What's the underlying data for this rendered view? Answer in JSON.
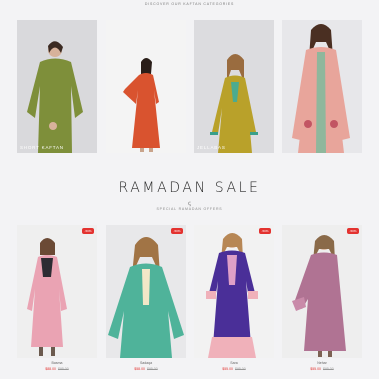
{
  "header": {
    "caption": "DISCOVER OUR KAFTAN CATEGORIES"
  },
  "categories": [
    {
      "label": "SHORT KAFTAN",
      "bg": "#d9d9dc",
      "dress": "#7e8f3a"
    },
    {
      "label": "",
      "bg": "#f4f4f4",
      "dress": "#d9532f"
    },
    {
      "label": "JELLABAS",
      "bg": "#dcdcdf",
      "dress": "#b9a12a"
    },
    {
      "label": "",
      "bg": "#e7e7ea",
      "dress": "#e8a59b"
    }
  ],
  "sale": {
    "title": "RAMADAN SALE",
    "ornament": "ꞔ",
    "subtitle": "SPECIAL RAMADAN OFFERS"
  },
  "products": [
    {
      "badge": "-50%",
      "name": "Basma",
      "price_now": "$88.00",
      "price_was": "$95.00",
      "bg": "#efefef",
      "dress": "#eaa3b3"
    },
    {
      "badge": "-50%",
      "name": "Sadaqa",
      "price_now": "$58.00",
      "price_was": "$95.00",
      "bg": "#e8e8ea",
      "dress": "#4fb39a"
    },
    {
      "badge": "-50%",
      "name": "Sara",
      "price_now": "$55.00",
      "price_was": "$95.00",
      "bg": "#f2f2f2",
      "dress": "#4a2f98"
    },
    {
      "badge": "-50%",
      "name": "Nehar",
      "price_now": "$55.00",
      "price_was": "$95.00",
      "bg": "#eeeeee",
      "dress": "#b07393"
    }
  ]
}
